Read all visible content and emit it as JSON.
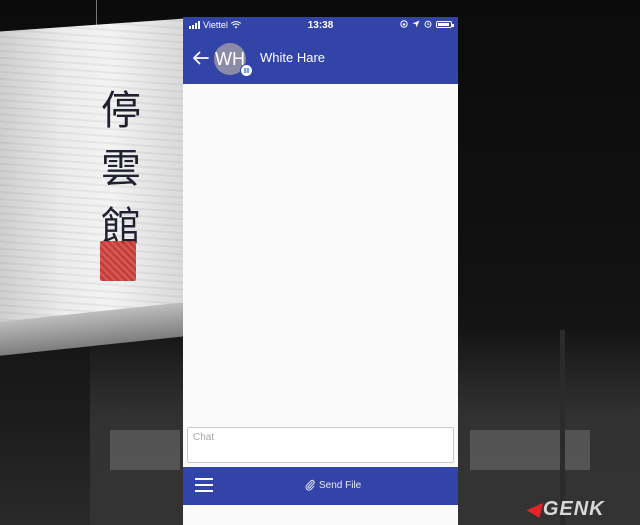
{
  "background": {
    "lamp_calligraphy": [
      "停",
      "雲",
      "館"
    ],
    "watermark": "GENK"
  },
  "status_bar": {
    "carrier": "Viettel",
    "time": "13:38"
  },
  "header": {
    "back_icon": "back-arrow-icon",
    "avatar_initials": "WH",
    "platform_badge_icon": "windows-icon",
    "contact_name": "White Hare"
  },
  "chat": {
    "input_placeholder": "Chat",
    "input_value": ""
  },
  "bottom_bar": {
    "menu_icon": "hamburger-menu-icon",
    "send_file_icon": "paperclip-icon",
    "send_file_label": "Send File"
  },
  "colors": {
    "primary": "#3344a8",
    "avatar": "#8d8aa8",
    "chat_background": "#fafafa"
  }
}
